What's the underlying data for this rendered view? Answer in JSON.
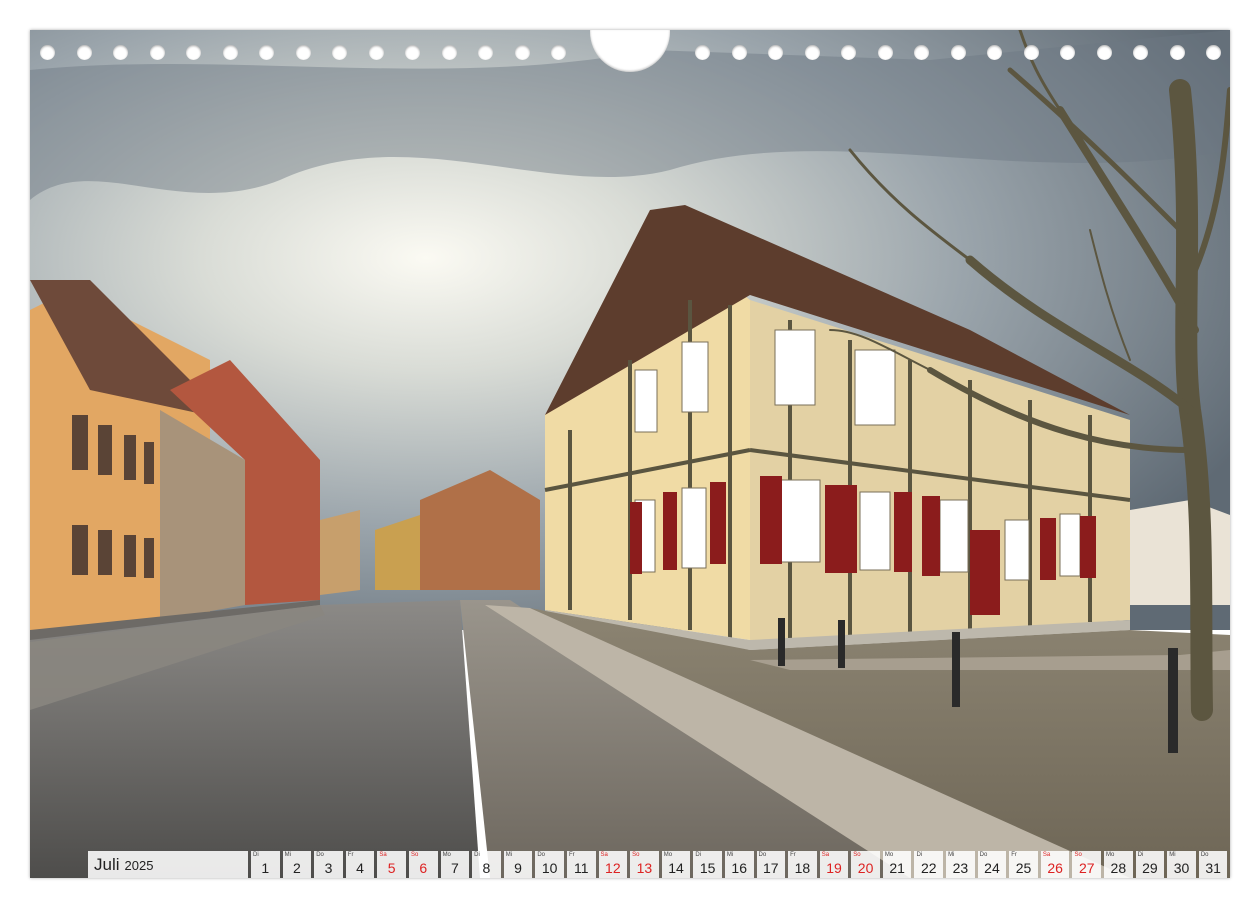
{
  "colors": {
    "weekend": "#dd2222",
    "cell_bg": "#ffffff",
    "text": "#222222"
  },
  "calendar": {
    "month": "Juli",
    "year": "2025",
    "days": [
      {
        "wd": "Di",
        "d": "1",
        "we": false
      },
      {
        "wd": "Mi",
        "d": "2",
        "we": false
      },
      {
        "wd": "Do",
        "d": "3",
        "we": false
      },
      {
        "wd": "Fr",
        "d": "4",
        "we": false
      },
      {
        "wd": "Sa",
        "d": "5",
        "we": true
      },
      {
        "wd": "So",
        "d": "6",
        "we": true
      },
      {
        "wd": "Mo",
        "d": "7",
        "we": false
      },
      {
        "wd": "Di",
        "d": "8",
        "we": false
      },
      {
        "wd": "Mi",
        "d": "9",
        "we": false
      },
      {
        "wd": "Do",
        "d": "10",
        "we": false
      },
      {
        "wd": "Fr",
        "d": "11",
        "we": false
      },
      {
        "wd": "Sa",
        "d": "12",
        "we": true
      },
      {
        "wd": "So",
        "d": "13",
        "we": true
      },
      {
        "wd": "Mo",
        "d": "14",
        "we": false
      },
      {
        "wd": "Di",
        "d": "15",
        "we": false
      },
      {
        "wd": "Mi",
        "d": "16",
        "we": false
      },
      {
        "wd": "Do",
        "d": "17",
        "we": false
      },
      {
        "wd": "Fr",
        "d": "18",
        "we": false
      },
      {
        "wd": "Sa",
        "d": "19",
        "we": true
      },
      {
        "wd": "So",
        "d": "20",
        "we": true
      },
      {
        "wd": "Mo",
        "d": "21",
        "we": false
      },
      {
        "wd": "Di",
        "d": "22",
        "we": false
      },
      {
        "wd": "Mi",
        "d": "23",
        "we": false
      },
      {
        "wd": "Do",
        "d": "24",
        "we": false
      },
      {
        "wd": "Fr",
        "d": "25",
        "we": false
      },
      {
        "wd": "Sa",
        "d": "26",
        "we": true
      },
      {
        "wd": "So",
        "d": "27",
        "we": true
      },
      {
        "wd": "Mo",
        "d": "28",
        "we": false
      },
      {
        "wd": "Di",
        "d": "29",
        "we": false
      },
      {
        "wd": "Mi",
        "d": "30",
        "we": false
      },
      {
        "wd": "Do",
        "d": "31",
        "we": false
      }
    ]
  }
}
